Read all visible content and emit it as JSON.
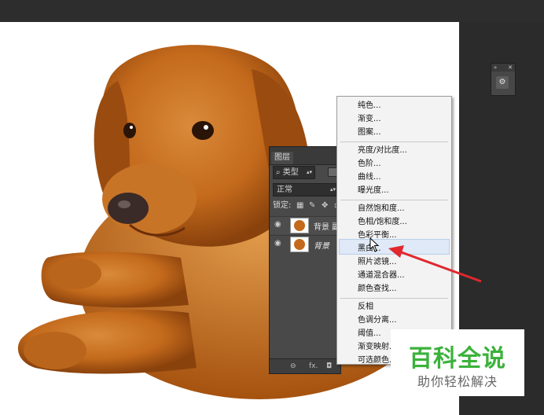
{
  "layers_panel": {
    "tab_label": "图层",
    "filter_label": "类型",
    "blend_mode": "正常",
    "lock_label": "锁定:",
    "layers": [
      {
        "name": "背景 副",
        "is_background": false
      },
      {
        "name": "背景",
        "is_background": true
      }
    ],
    "footer_icons": [
      "link-icon",
      "fx-icon",
      "mask-icon"
    ],
    "footer_fx": "fx."
  },
  "adjustment_menu": {
    "groups": [
      [
        "纯色...",
        "渐变...",
        "图案..."
      ],
      [
        "亮度/对比度...",
        "色阶...",
        "曲线...",
        "曝光度..."
      ],
      [
        "自然饱和度...",
        "色相/饱和度...",
        "色彩平衡...",
        "黑白...",
        "照片滤镜...",
        "通道混合器...",
        "颜色查找..."
      ],
      [
        "反相",
        "色调分离...",
        "阈值...",
        "渐变映射...",
        "可选颜色..."
      ]
    ],
    "highlighted_item": "黑白..."
  },
  "watermark": {
    "title": "百科全说",
    "subtitle": "助你轻松解决"
  },
  "colors": {
    "accent_arrow": "#e0282e",
    "watermark_green": "#3bb23b",
    "dog_fur": "#c46a1c"
  }
}
